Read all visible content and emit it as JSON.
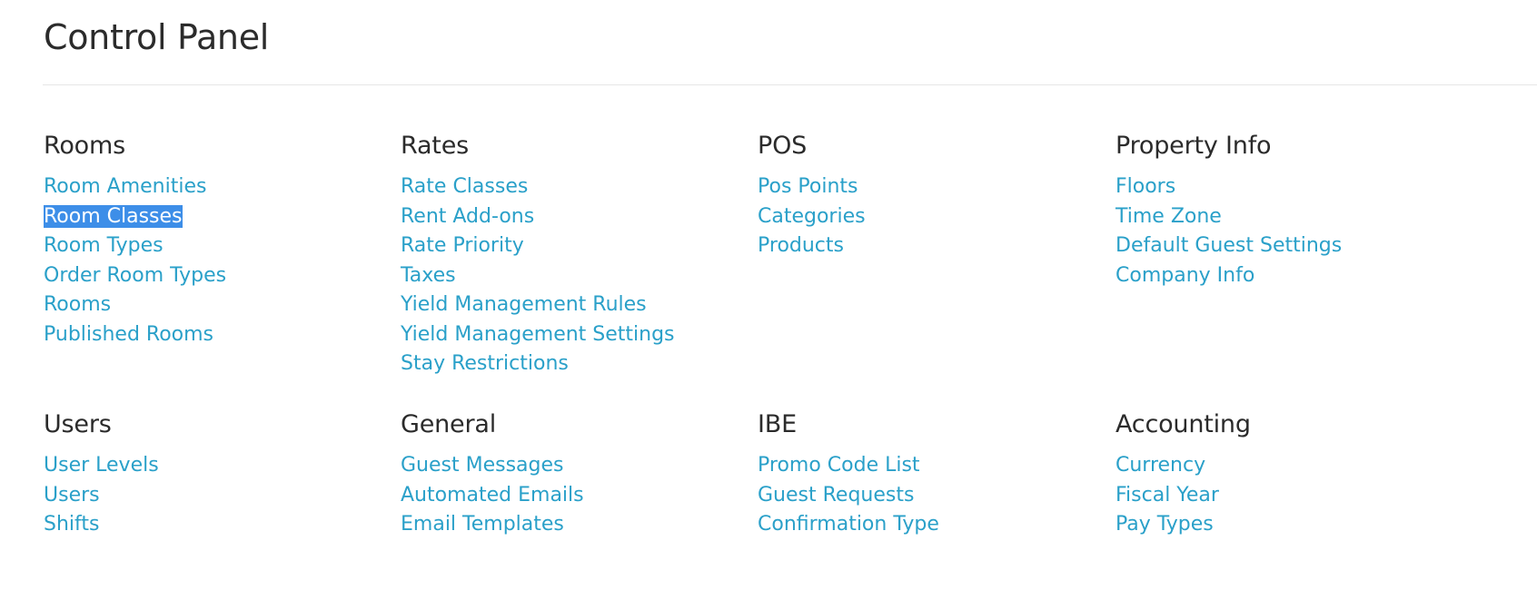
{
  "page": {
    "title": "Control Panel"
  },
  "colors": {
    "link": "#2aa0c9",
    "heading": "#2b2b2b",
    "selection_background": "#3d8ee8",
    "selection_text": "#ffffff",
    "divider": "#e6e6e6"
  },
  "sections": [
    {
      "id": "rooms",
      "heading": "Rooms",
      "links": [
        "Room Amenities",
        "Room Classes",
        "Room Types",
        "Order Room Types",
        "Rooms",
        "Published Rooms"
      ]
    },
    {
      "id": "rates",
      "heading": "Rates",
      "links": [
        "Rate Classes",
        "Rent Add-ons",
        "Rate Priority",
        "Taxes",
        "Yield Management Rules",
        "Yield Management Settings",
        "Stay Restrictions"
      ]
    },
    {
      "id": "pos",
      "heading": "POS",
      "links": [
        "Pos Points",
        "Categories",
        "Products"
      ]
    },
    {
      "id": "property-info",
      "heading": "Property Info",
      "links": [
        "Floors",
        "Time Zone",
        "Default Guest Settings",
        "Company Info"
      ]
    },
    {
      "id": "users",
      "heading": "Users",
      "links": [
        "User Levels",
        "Users",
        "Shifts"
      ]
    },
    {
      "id": "general",
      "heading": "General",
      "links": [
        "Guest Messages",
        "Automated Emails",
        "Email Templates"
      ]
    },
    {
      "id": "ibe",
      "heading": "IBE",
      "links": [
        "Promo Code List",
        "Guest Requests",
        "Confirmation Type"
      ]
    },
    {
      "id": "accounting",
      "heading": "Accounting",
      "links": [
        "Currency",
        "Fiscal Year",
        "Pay Types"
      ]
    }
  ],
  "selected_link": "Room Classes"
}
